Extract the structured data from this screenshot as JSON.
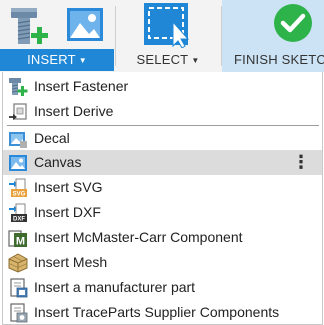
{
  "toolbar": {
    "insert": {
      "label": "INSERT",
      "icons": [
        "fastener-plus-icon",
        "image-icon"
      ],
      "active": true
    },
    "select": {
      "label": "SELECT",
      "icons": [
        "selection-cursor-icon"
      ]
    },
    "finish": {
      "label": "FINISH SKETCH",
      "icons": [
        "check-circle-icon"
      ]
    }
  },
  "menu": {
    "items": [
      {
        "label": "Insert Fastener",
        "icon": "fastener-plus-icon"
      },
      {
        "label": "Insert Derive",
        "icon": "derive-icon"
      },
      {
        "label": "Decal",
        "icon": "decal-icon"
      },
      {
        "label": "Canvas",
        "icon": "canvas-image-icon",
        "highlighted": true,
        "more": "⋮"
      },
      {
        "label": "Insert SVG",
        "icon": "svg-file-icon",
        "badge": "SVG"
      },
      {
        "label": "Insert DXF",
        "icon": "dxf-file-icon",
        "badge": "DXF"
      },
      {
        "label": "Insert McMaster-Carr Component",
        "icon": "mcmaster-icon",
        "badge": "M"
      },
      {
        "label": "Insert Mesh",
        "icon": "mesh-icon"
      },
      {
        "label": "Insert a manufacturer part",
        "icon": "manufacturer-part-icon"
      },
      {
        "label": "Insert TraceParts Supplier Components",
        "icon": "traceparts-icon"
      }
    ]
  },
  "colors": {
    "accent": "#1f87d6",
    "finish_bg": "#cbe3f4",
    "check_green": "#2eb24a",
    "highlight": "#dcdcdc"
  }
}
